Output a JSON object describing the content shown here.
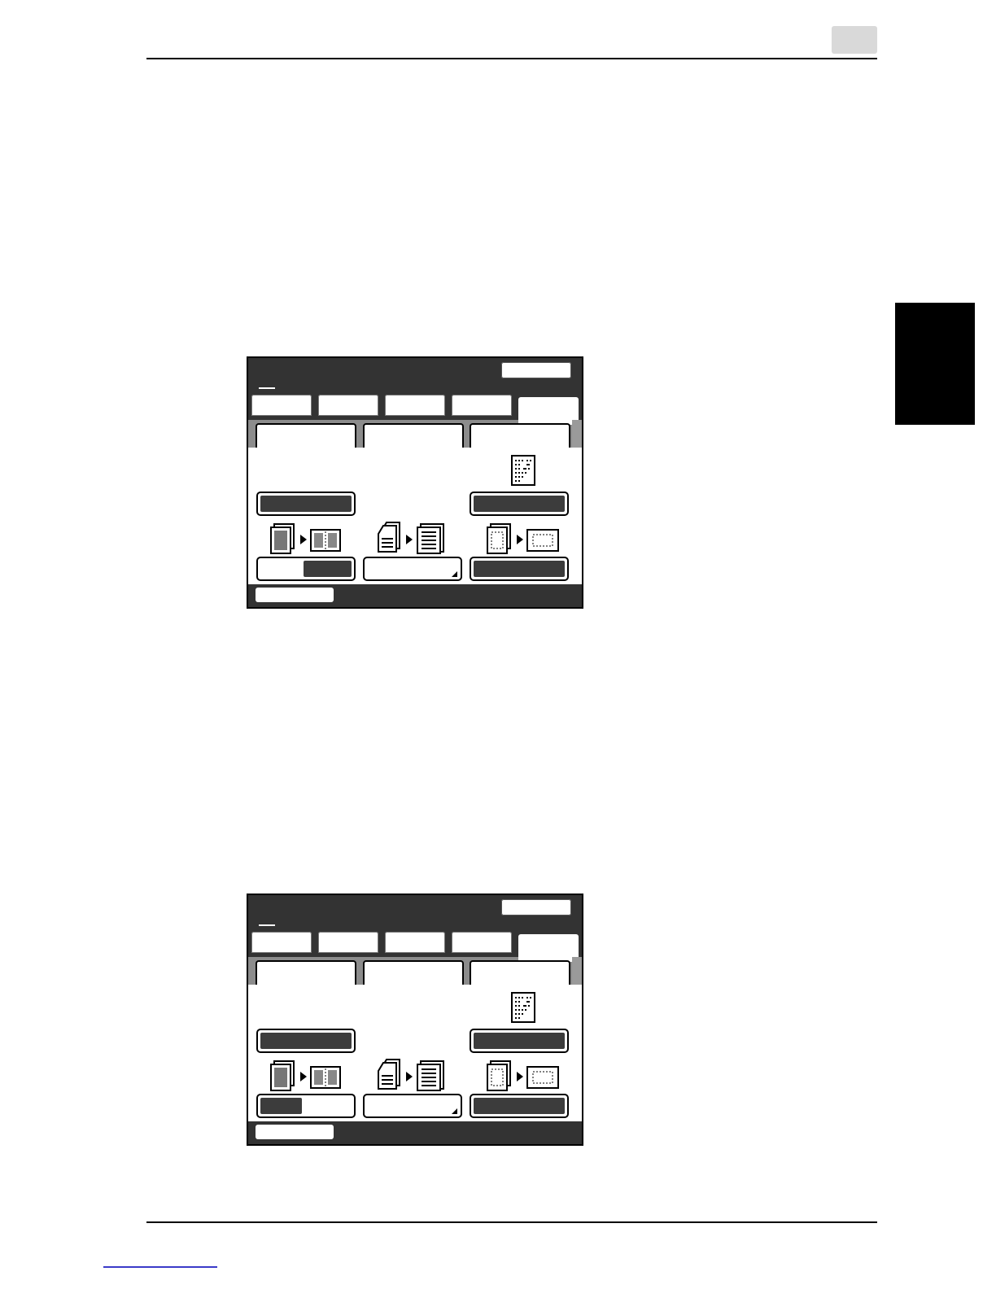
{
  "page": {
    "chapter_number": "",
    "header_text": "",
    "footer_text": ""
  },
  "colors": {
    "panel_dark": "#333333",
    "button_fill": "#3c3c3c",
    "tab_band": "#8c8c8c",
    "chapter_box": "#d9d9d9",
    "side_tab": "#000000",
    "link_line": "#3a3ac9"
  },
  "panels": [
    {
      "id": "panel-1",
      "main_tabs": [
        "",
        "",
        "",
        "",
        ""
      ],
      "active_main_tab": 4,
      "sub_tabs": [
        "",
        "",
        ""
      ],
      "active_sub_tab": 0,
      "buttons": {
        "left_top": "",
        "right_top": "",
        "left_bottom": "",
        "center_bottom": "",
        "right_bottom": ""
      },
      "left_bottom_state": "right-half-filled",
      "icons": [
        "single-page-document-icon",
        "book-spread-icon",
        "stacked-pages-icon",
        "text-document-icon",
        "portrait-page-icon",
        "landscape-page-icon",
        "arrow-right-icon"
      ]
    },
    {
      "id": "panel-2",
      "main_tabs": [
        "",
        "",
        "",
        "",
        ""
      ],
      "active_main_tab": 4,
      "sub_tabs": [
        "",
        "",
        ""
      ],
      "active_sub_tab": 0,
      "buttons": {
        "left_top": "",
        "right_top": "",
        "left_bottom": "",
        "center_bottom": "",
        "right_bottom": ""
      },
      "left_bottom_state": "left-half-filled",
      "icons": [
        "single-page-document-icon",
        "book-spread-icon",
        "stacked-pages-icon",
        "text-document-icon",
        "portrait-page-icon",
        "landscape-page-icon",
        "arrow-right-icon"
      ]
    }
  ]
}
